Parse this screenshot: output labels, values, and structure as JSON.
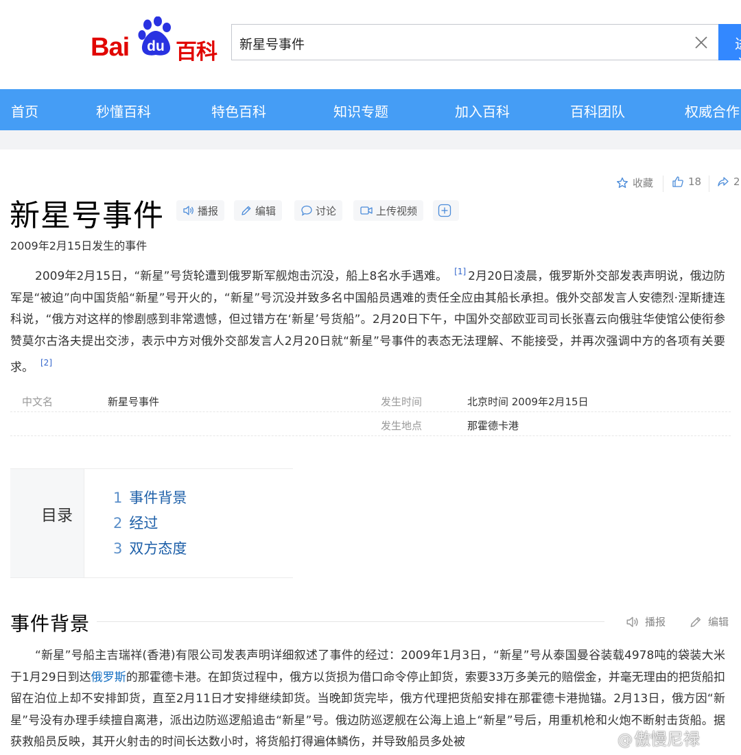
{
  "header": {
    "logo_text": "Baidu百科",
    "logo_bai": "Bai",
    "logo_du": "du",
    "logo_baike": "百科",
    "search_value": "新星号事件",
    "search_button_label": "进入词条",
    "brand_color": "#e10602",
    "icons": {
      "clear": "close-icon"
    }
  },
  "nav": {
    "background": "#459df5",
    "items": [
      "首页",
      "秒懂百科",
      "特色百科",
      "知识专题",
      "加入百科",
      "百科团队",
      "权威合作"
    ]
  },
  "entry": {
    "title": "新星号事件",
    "subtitle": "2009年2月15日发生的事件",
    "tools": [
      {
        "label": "播报",
        "icon": "speaker-icon"
      },
      {
        "label": "编辑",
        "icon": "pencil-icon"
      },
      {
        "label": "讨论",
        "icon": "comment-icon"
      },
      {
        "label": "上传视频",
        "icon": "video-icon"
      },
      {
        "label": "",
        "icon": "plus-icon"
      }
    ],
    "actions": {
      "collect_label": "收藏",
      "like_count": "18",
      "share_count": "2"
    }
  },
  "summary": {
    "part1": "2009年2月15日，“新星”号货轮遭到俄罗斯军舰炮击沉没，船上8名水手遇难。",
    "ref1": "[1]",
    "part2": "2月20日凌晨，俄罗斯外交部发表声明说，俄边防军是“被迫”向中国货船“新星”号开火的，“新星”号沉没并致多名中国船员遇难的责任全应由其船长承担。俄外交部发言人安德烈·涅斯捷连科说，“俄方对这样的惨剧感到非常遗憾，但过错方在‘新星’号货船”。2月20日下午，中国外交部欧亚司司长张喜云向俄驻华使馆公使衔参赞莫尔古洛夫提出交涉，表示中方对俄外交部发言人2月20日就“新星”号事件的表态无法理解、不能接受，并再次强调中方的各项有关要求。",
    "ref2": "[2]"
  },
  "basic_info": {
    "row1": {
      "key1": "中文名",
      "val1": "新星号事件",
      "key2": "发生时间",
      "val2": "北京时间 2009年2月15日"
    },
    "row2": {
      "key2": "发生地点",
      "val2": "那霍德卡港"
    }
  },
  "toc": {
    "title": "目录",
    "items": [
      {
        "num": "1",
        "label": "事件背景"
      },
      {
        "num": "2",
        "label": "经过"
      },
      {
        "num": "3",
        "label": "双方态度"
      }
    ]
  },
  "section1": {
    "title": "事件背景",
    "action_play": "播报",
    "action_edit": "编辑",
    "text_a": "“新星”号船主吉瑞祥(香港)有限公司发表声明详细叙述了事件的经过：2009年1月3日，“新星”号从泰国曼谷装载4978吨的袋装大米于1月29日到达",
    "link": "俄罗斯",
    "text_b": "的那霍德卡港。在卸货过程中，俄方以货损为借口命令停止卸货，索要33万多美元的赔偿金，并毫无理由的把货船扣留在泊位上却不安排卸货，直至2月11日才安排继续卸货。当晚卸货完毕，俄方代理把货船安排在那霍德卡港抛锚。2月13日，俄方因“新星”号没有办理手续擅自离港，派出边防巡逻船追击“新星”号。俄边防巡逻舰在公海上追上“新星”号后，用重机枪和火炮不断射击货船。据获救船员反映，其开火射击的时间长达数小时，将货船打得遍体鳞伤，并导致船员多处被"
  },
  "watermark": {
    "at": "@",
    "name": "傲慢尼禄"
  }
}
